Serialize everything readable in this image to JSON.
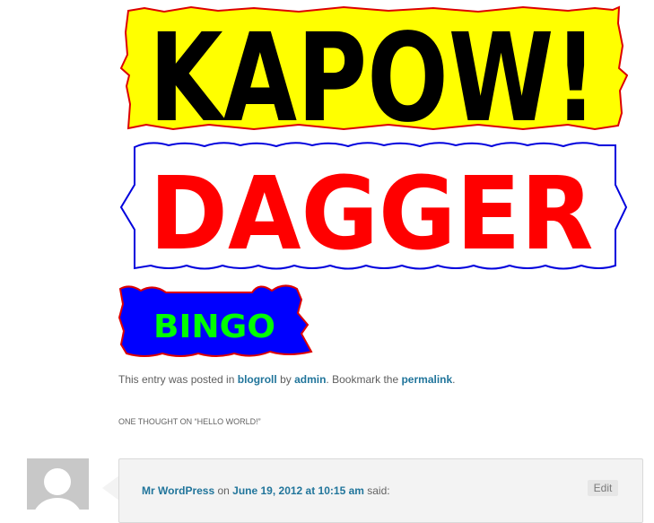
{
  "banners": {
    "kapow": {
      "text": "KAPOW!",
      "bg": "#ffff00",
      "border": "#dd0000",
      "text_color": "#000000"
    },
    "dagger": {
      "text": "DAGGER",
      "bg": "#ffffff",
      "border": "#0000dd",
      "text_color": "#ff0000"
    },
    "bingo": {
      "text": "BINGO",
      "bg": "#0000ff",
      "border": "#dd0000",
      "text_color": "#00ff00"
    }
  },
  "entry_meta": {
    "prefix": "This entry was posted in ",
    "category": "blogroll",
    "by": " by ",
    "author": "admin",
    "bookmark": ". Bookmark the ",
    "permalink": "permalink",
    "end": "."
  },
  "comments": {
    "heading": "One thought on “Hello world!”",
    "items": [
      {
        "author": "Mr WordPress",
        "on": " on ",
        "date": "June 19, 2012 at 10:15 am",
        "said": " said:",
        "edit_label": "Edit"
      }
    ]
  },
  "colors": {
    "link": "#21759b",
    "text": "#5e5e5e"
  }
}
